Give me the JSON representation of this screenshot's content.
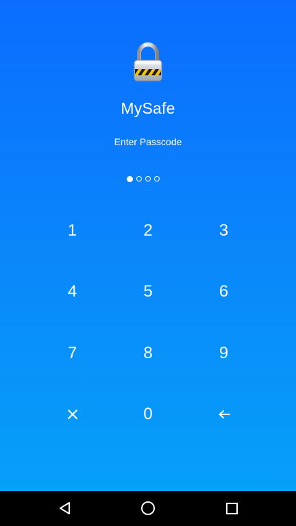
{
  "app": {
    "title": "MySafe",
    "prompt": "Enter Passcode",
    "lock_icon": "padlock-icon"
  },
  "passcode": {
    "length": 4,
    "entered": 1
  },
  "keypad": {
    "keys": [
      {
        "label": "1",
        "name": "key-1"
      },
      {
        "label": "2",
        "name": "key-2"
      },
      {
        "label": "3",
        "name": "key-3"
      },
      {
        "label": "4",
        "name": "key-4"
      },
      {
        "label": "5",
        "name": "key-5"
      },
      {
        "label": "6",
        "name": "key-6"
      },
      {
        "label": "7",
        "name": "key-7"
      },
      {
        "label": "8",
        "name": "key-8"
      },
      {
        "label": "9",
        "name": "key-9"
      },
      {
        "label": "",
        "name": "clear-key",
        "icon": "close-icon"
      },
      {
        "label": "0",
        "name": "key-0"
      },
      {
        "label": "",
        "name": "backspace-key",
        "icon": "arrow-left-icon"
      }
    ]
  },
  "navbar": {
    "back_icon": "back-triangle-icon",
    "home_icon": "home-circle-icon",
    "recents_icon": "recents-square-icon"
  },
  "colors": {
    "gradient_top": "#0a6dff",
    "gradient_bottom": "#05a0f8",
    "text": "#ffffff",
    "navbar": "#000000"
  }
}
